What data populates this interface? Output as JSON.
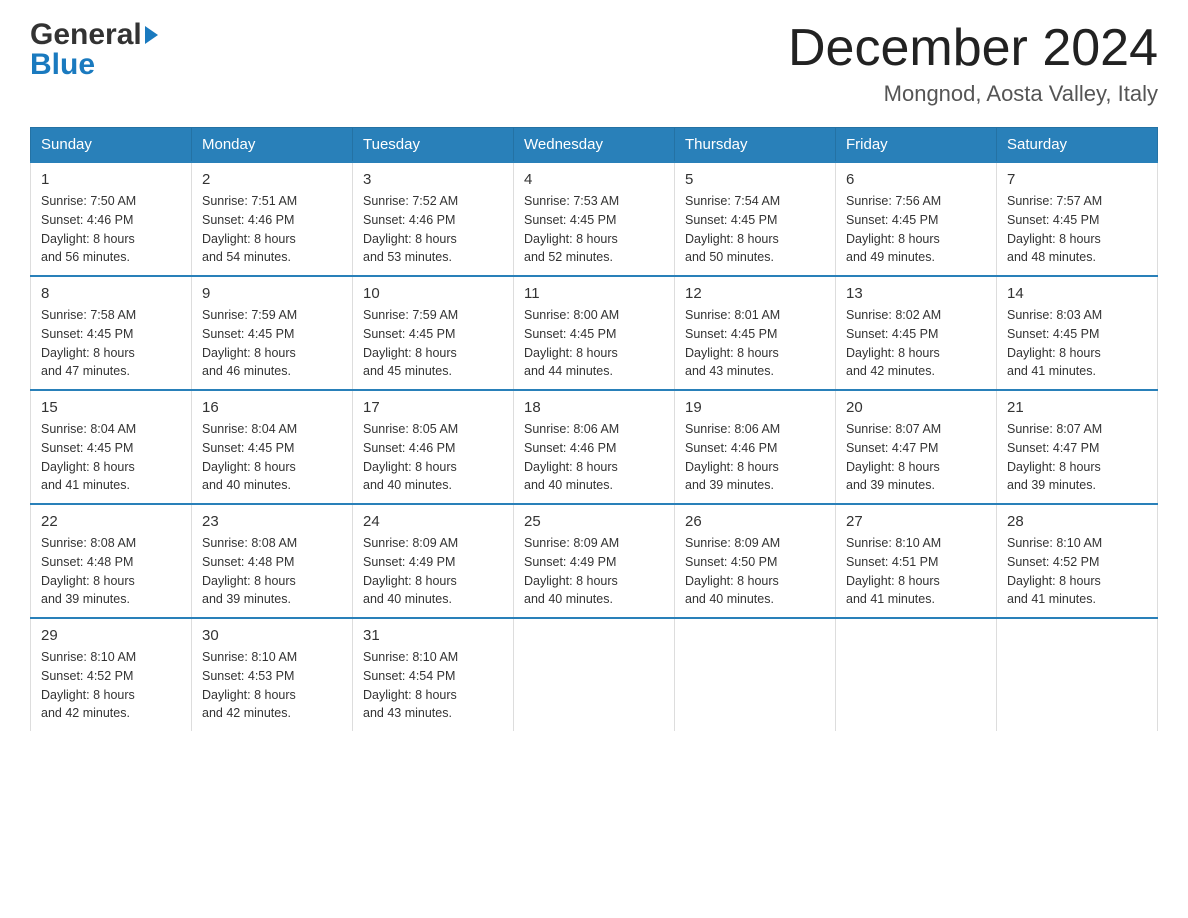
{
  "header": {
    "logo_line1": "General",
    "logo_line2": "Blue",
    "month_year": "December 2024",
    "location": "Mongnod, Aosta Valley, Italy"
  },
  "days_of_week": [
    "Sunday",
    "Monday",
    "Tuesday",
    "Wednesday",
    "Thursday",
    "Friday",
    "Saturday"
  ],
  "weeks": [
    [
      {
        "day": "1",
        "sunrise": "7:50 AM",
        "sunset": "4:46 PM",
        "daylight": "8 hours and 56 minutes."
      },
      {
        "day": "2",
        "sunrise": "7:51 AM",
        "sunset": "4:46 PM",
        "daylight": "8 hours and 54 minutes."
      },
      {
        "day": "3",
        "sunrise": "7:52 AM",
        "sunset": "4:46 PM",
        "daylight": "8 hours and 53 minutes."
      },
      {
        "day": "4",
        "sunrise": "7:53 AM",
        "sunset": "4:45 PM",
        "daylight": "8 hours and 52 minutes."
      },
      {
        "day": "5",
        "sunrise": "7:54 AM",
        "sunset": "4:45 PM",
        "daylight": "8 hours and 50 minutes."
      },
      {
        "day": "6",
        "sunrise": "7:56 AM",
        "sunset": "4:45 PM",
        "daylight": "8 hours and 49 minutes."
      },
      {
        "day": "7",
        "sunrise": "7:57 AM",
        "sunset": "4:45 PM",
        "daylight": "8 hours and 48 minutes."
      }
    ],
    [
      {
        "day": "8",
        "sunrise": "7:58 AM",
        "sunset": "4:45 PM",
        "daylight": "8 hours and 47 minutes."
      },
      {
        "day": "9",
        "sunrise": "7:59 AM",
        "sunset": "4:45 PM",
        "daylight": "8 hours and 46 minutes."
      },
      {
        "day": "10",
        "sunrise": "7:59 AM",
        "sunset": "4:45 PM",
        "daylight": "8 hours and 45 minutes."
      },
      {
        "day": "11",
        "sunrise": "8:00 AM",
        "sunset": "4:45 PM",
        "daylight": "8 hours and 44 minutes."
      },
      {
        "day": "12",
        "sunrise": "8:01 AM",
        "sunset": "4:45 PM",
        "daylight": "8 hours and 43 minutes."
      },
      {
        "day": "13",
        "sunrise": "8:02 AM",
        "sunset": "4:45 PM",
        "daylight": "8 hours and 42 minutes."
      },
      {
        "day": "14",
        "sunrise": "8:03 AM",
        "sunset": "4:45 PM",
        "daylight": "8 hours and 41 minutes."
      }
    ],
    [
      {
        "day": "15",
        "sunrise": "8:04 AM",
        "sunset": "4:45 PM",
        "daylight": "8 hours and 41 minutes."
      },
      {
        "day": "16",
        "sunrise": "8:04 AM",
        "sunset": "4:45 PM",
        "daylight": "8 hours and 40 minutes."
      },
      {
        "day": "17",
        "sunrise": "8:05 AM",
        "sunset": "4:46 PM",
        "daylight": "8 hours and 40 minutes."
      },
      {
        "day": "18",
        "sunrise": "8:06 AM",
        "sunset": "4:46 PM",
        "daylight": "8 hours and 40 minutes."
      },
      {
        "day": "19",
        "sunrise": "8:06 AM",
        "sunset": "4:46 PM",
        "daylight": "8 hours and 39 minutes."
      },
      {
        "day": "20",
        "sunrise": "8:07 AM",
        "sunset": "4:47 PM",
        "daylight": "8 hours and 39 minutes."
      },
      {
        "day": "21",
        "sunrise": "8:07 AM",
        "sunset": "4:47 PM",
        "daylight": "8 hours and 39 minutes."
      }
    ],
    [
      {
        "day": "22",
        "sunrise": "8:08 AM",
        "sunset": "4:48 PM",
        "daylight": "8 hours and 39 minutes."
      },
      {
        "day": "23",
        "sunrise": "8:08 AM",
        "sunset": "4:48 PM",
        "daylight": "8 hours and 39 minutes."
      },
      {
        "day": "24",
        "sunrise": "8:09 AM",
        "sunset": "4:49 PM",
        "daylight": "8 hours and 40 minutes."
      },
      {
        "day": "25",
        "sunrise": "8:09 AM",
        "sunset": "4:49 PM",
        "daylight": "8 hours and 40 minutes."
      },
      {
        "day": "26",
        "sunrise": "8:09 AM",
        "sunset": "4:50 PM",
        "daylight": "8 hours and 40 minutes."
      },
      {
        "day": "27",
        "sunrise": "8:10 AM",
        "sunset": "4:51 PM",
        "daylight": "8 hours and 41 minutes."
      },
      {
        "day": "28",
        "sunrise": "8:10 AM",
        "sunset": "4:52 PM",
        "daylight": "8 hours and 41 minutes."
      }
    ],
    [
      {
        "day": "29",
        "sunrise": "8:10 AM",
        "sunset": "4:52 PM",
        "daylight": "8 hours and 42 minutes."
      },
      {
        "day": "30",
        "sunrise": "8:10 AM",
        "sunset": "4:53 PM",
        "daylight": "8 hours and 42 minutes."
      },
      {
        "day": "31",
        "sunrise": "8:10 AM",
        "sunset": "4:54 PM",
        "daylight": "8 hours and 43 minutes."
      },
      null,
      null,
      null,
      null
    ]
  ],
  "labels": {
    "sunrise": "Sunrise: ",
    "sunset": "Sunset: ",
    "daylight": "Daylight: "
  }
}
